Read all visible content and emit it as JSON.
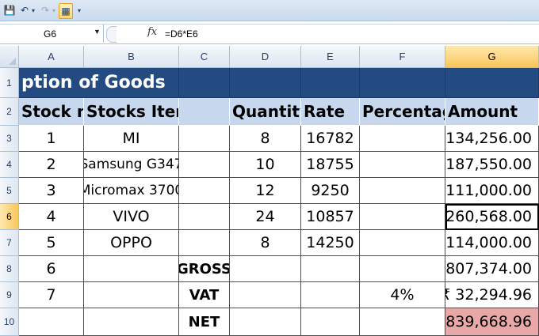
{
  "formula_bar": {
    "name_box": "G6",
    "fx_label": "fx",
    "formula": "=D6*E6"
  },
  "columns": [
    "A",
    "B",
    "C",
    "D",
    "E",
    "F",
    "G"
  ],
  "rows": [
    "1",
    "2",
    "3",
    "4",
    "5",
    "6",
    "7",
    "8",
    "9",
    "10"
  ],
  "sheet": {
    "title": "ption of Goods",
    "headers": {
      "A": "Stock no.",
      "B": "Stocks Items",
      "C": "",
      "D": "Quantity",
      "E": "Rate",
      "F": "Percentage",
      "G": "Amount"
    },
    "items": [
      {
        "no": "1",
        "item": "MI",
        "qty": "8",
        "rate": "16782",
        "amount": "₹ 134,256.00"
      },
      {
        "no": "2",
        "item": "Samsung G347",
        "qty": "10",
        "rate": "18755",
        "amount": "₹ 187,550.00"
      },
      {
        "no": "3",
        "item": "Micromax 3700",
        "qty": "12",
        "rate": "9250",
        "amount": "₹ 111,000.00"
      },
      {
        "no": "4",
        "item": "VIVO",
        "qty": "24",
        "rate": "10857",
        "amount": "₹ 260,568.00"
      },
      {
        "no": "5",
        "item": "OPPO",
        "qty": "8",
        "rate": "14250",
        "amount": "₹ 114,000.00"
      }
    ],
    "gross": {
      "no": "6",
      "label": "GROSS",
      "amount": "₹ 807,374.00"
    },
    "vat": {
      "no": "7",
      "label": "VAT",
      "percentage": "4%",
      "amount": "₹ 32,294.96"
    },
    "net": {
      "label": "NET",
      "amount": "₹ 839,668.96"
    }
  },
  "colors": {
    "title_fill": "#244a82",
    "header_fill": "#c6d7ee",
    "net_fill": "#e9a8a8",
    "selected_header": "#f9c65a"
  }
}
